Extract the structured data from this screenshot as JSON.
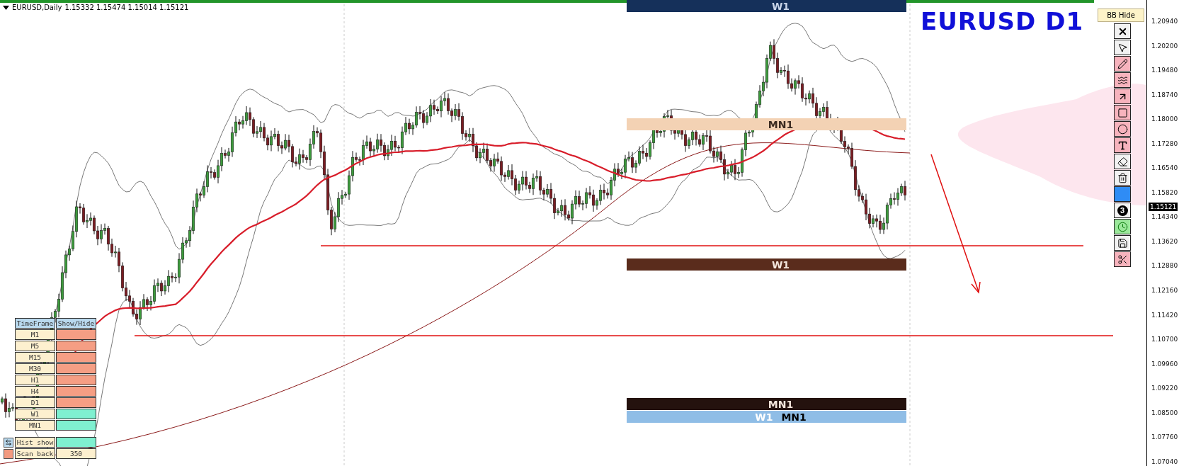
{
  "chart_header": {
    "symbol": "EURUSD,Daily",
    "ohlc": "1.15332 1.15474 1.15014 1.15121"
  },
  "big_label": "EURUSD D1",
  "bb_button": "BB Hide",
  "toolbar": [
    {
      "kind": "close",
      "color": "#f2f2f2"
    },
    {
      "kind": "pointer",
      "color": "#f2f2f2"
    },
    {
      "kind": "pencil",
      "color": "#f7b3bd"
    },
    {
      "kind": "waves",
      "color": "#f7b3bd"
    },
    {
      "kind": "arrow",
      "color": "#f7b3bd"
    },
    {
      "kind": "square",
      "color": "#f7b3bd"
    },
    {
      "kind": "circle",
      "color": "#f7b3bd"
    },
    {
      "kind": "text",
      "color": "#f7b3bd"
    },
    {
      "kind": "eraser",
      "color": "#f2f2f2"
    },
    {
      "kind": "trash",
      "color": "#f2f2f2"
    },
    {
      "kind": "swatch",
      "color": "#2f8cf5"
    },
    {
      "kind": "number",
      "color": "#f2f2f2",
      "text": "3"
    },
    {
      "kind": "clock",
      "color": "#9be89b"
    },
    {
      "kind": "save",
      "color": "#f2f2f2"
    },
    {
      "kind": "scissors",
      "color": "#f7b3bd"
    }
  ],
  "zones": [
    {
      "color": "#15305a",
      "labels": [
        {
          "text": "W1",
          "color": "#c8d4e8"
        }
      ]
    },
    {
      "color": "#f3d2b4",
      "labels": [
        {
          "text": "MN1",
          "color": "#3a2a20"
        }
      ]
    },
    {
      "color": "#5a2c1c",
      "labels": [
        {
          "text": "W1"
        }
      ]
    },
    {
      "color": "#24120e",
      "labels": [
        {
          "text": "MN1"
        }
      ]
    },
    {
      "color": "#8fbde6",
      "labels": [
        {
          "text": "W1",
          "color": "#ffffff"
        },
        {
          "text": "MN1",
          "color": "#000000"
        }
      ]
    }
  ],
  "price_axis": {
    "ticks": [
      "1.20940",
      "1.20200",
      "1.19480",
      "1.18740",
      "1.18000",
      "1.17280",
      "1.16540",
      "1.15820",
      "1.14340",
      "1.13620",
      "1.12880",
      "1.12160",
      "1.11420",
      "1.10700",
      "1.09960",
      "1.09220",
      "1.08500",
      "1.07760",
      "1.07040"
    ],
    "current": "1.15121"
  },
  "timeframe_panel": {
    "header": [
      "TimeFrame",
      "Show/Hide"
    ],
    "rows": [
      {
        "label": "M1",
        "visible": false
      },
      {
        "label": "M5",
        "visible": false
      },
      {
        "label": "M15",
        "visible": false
      },
      {
        "label": "M30",
        "visible": false
      },
      {
        "label": "H1",
        "visible": false
      },
      {
        "label": "H4",
        "visible": false
      },
      {
        "label": "D1",
        "visible": false
      },
      {
        "label": "W1",
        "visible": true
      },
      {
        "label": "MN1",
        "visible": true
      }
    ],
    "hist": {
      "label": "Hist show",
      "on": true
    },
    "scan": {
      "label": "Scan back",
      "value": "350"
    }
  }
}
